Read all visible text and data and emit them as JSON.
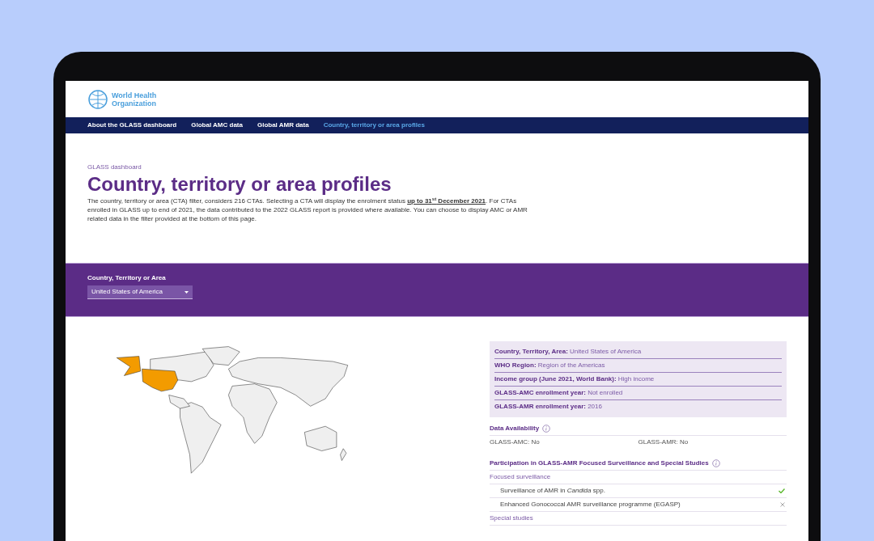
{
  "header": {
    "logo_text": [
      "World Health",
      "Organization"
    ]
  },
  "nav": [
    {
      "label": "About the GLASS dashboard",
      "selected": false
    },
    {
      "label": "Global AMC data",
      "selected": false
    },
    {
      "label": "Global AMR data",
      "selected": false
    },
    {
      "label": "Country, territory or area profiles",
      "selected": true
    }
  ],
  "hero": {
    "breadcrumb": "GLASS dashboard",
    "title": "Country, territory or area profiles",
    "intro": "The country, territory or area (CTA) filter, considers 216 CTAs. Selecting a CTA will display the enrolment status **up to 31$^{st}$ December 2021**. For CTAs enrolled in GLASS up to end of 2021, the data contributed to the 2022 GLASS report is provided where available. You can choose to display AMC or AMR related data in the filter provided at the bottom of this page."
  },
  "filter": {
    "label": "Country, Territory or Area",
    "value": "United States of America"
  },
  "profile": [
    {
      "label": "Country, Territory, Area:",
      "value": "United States of America"
    },
    {
      "label": "WHO Region:",
      "value": "Region of the Americas"
    },
    {
      "label": "Income group (June 2021, World Bank):",
      "value": "High income"
    },
    {
      "label": "GLASS-AMC enrollment year:",
      "value": "Not enrolled"
    },
    {
      "label": "GLASS-AMR enrollment year:",
      "value": "2016"
    }
  ],
  "data_availability": {
    "title": "Data Availability",
    "items": [
      "GLASS-AMC: No",
      "GLASS-AMR: No"
    ]
  },
  "participation": {
    "title": "Participation in GLASS-AMR Focused Surveillance and Special Studies",
    "groups": [
      {
        "title": "Focused surveillance",
        "items": [
          {
            "text": "Surveillance of AMR in *Candida* spp.",
            "participating": true
          },
          {
            "text": "Enhanced Gonococcal AMR surveillance programme (EGASP)",
            "participating": false
          }
        ]
      },
      {
        "title": "Special studies"
      }
    ]
  }
}
